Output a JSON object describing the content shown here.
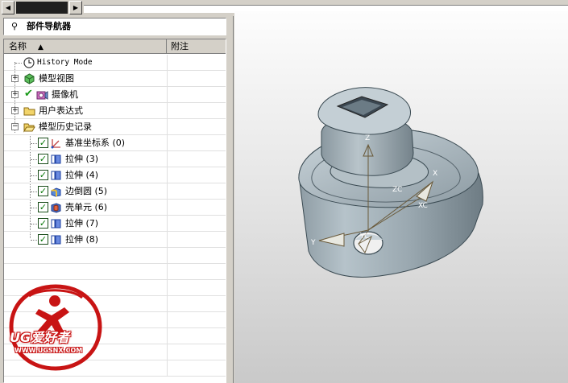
{
  "panel": {
    "title": "部件导航器",
    "columns": {
      "name": "名称",
      "note": "附注"
    }
  },
  "tree": {
    "history_mode": "History Mode",
    "model_views": "模型视图",
    "cameras": "摄像机",
    "user_expressions": "用户表达式",
    "model_history": "模型历史记录"
  },
  "features": [
    {
      "label": "基准坐标系 (0)",
      "icon": "datum-csys-icon"
    },
    {
      "label": "拉伸 (3)",
      "icon": "extrude-icon"
    },
    {
      "label": "拉伸 (4)",
      "icon": "extrude-icon"
    },
    {
      "label": "边倒圆 (5)",
      "icon": "edge-blend-icon"
    },
    {
      "label": "壳单元 (6)",
      "icon": "shell-icon"
    },
    {
      "label": "拉伸 (7)",
      "icon": "extrude-icon"
    },
    {
      "label": "拉伸 (8)",
      "icon": "extrude-icon"
    }
  ],
  "viewport": {
    "axes": {
      "z": "Z",
      "zc": "ZC",
      "x": "X",
      "xc": "XC",
      "y": "Y",
      "yc": "YC"
    }
  },
  "watermark": {
    "brand": "UG爱好者",
    "url": "WWW.UGSNX.COM"
  },
  "colors": {
    "panel_bg": "#d4d0c8",
    "check": "#0a7a0a",
    "watermark": "#c81414",
    "model": "#9aaab2"
  }
}
